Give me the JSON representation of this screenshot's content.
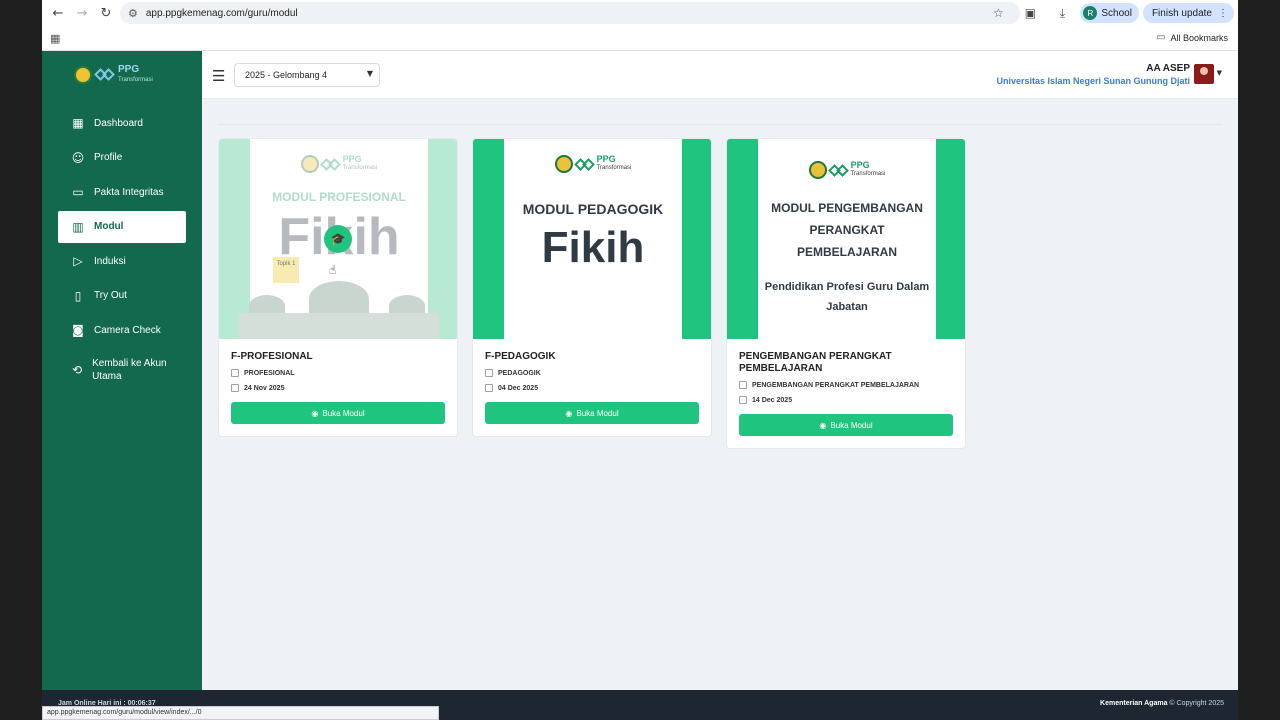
{
  "browser": {
    "url": "app.ppgkemenag.com/guru/modul",
    "profile_initial": "R",
    "profile_label": "School",
    "update_label": "Finish update",
    "bookmarks_label": "All Bookmarks"
  },
  "logo": {
    "text": "PPG",
    "sub": "Transformasi"
  },
  "sidebar": {
    "items": [
      {
        "label": "Dashboard"
      },
      {
        "label": "Profile"
      },
      {
        "label": "Pakta Integritas"
      },
      {
        "label": "Modul"
      },
      {
        "label": "Induksi"
      },
      {
        "label": "Try Out"
      },
      {
        "label": "Camera Check"
      },
      {
        "label": "Kembali ke Akun Utama"
      }
    ]
  },
  "header": {
    "period_select": "2025 - Gelombang 4",
    "user_name": "AA ASEP",
    "university": "Universitas Islam Negeri Sunan Gunung Djati"
  },
  "cards": [
    {
      "img_title": "MODUL PROFESIONAL",
      "img_big": "Fikih",
      "topic_tag": "Topik 1",
      "title": "F-PROFESIONAL",
      "category": "PROFESIONAL",
      "date": "24 Nov 2025",
      "button": "Buka Modul"
    },
    {
      "img_title": "MODUL PEDAGOGIK",
      "img_big": "Fikih",
      "title": "F-PEDAGOGIK",
      "category": "PEDAGOGIK",
      "date": "04 Dec 2025",
      "button": "Buka Modul"
    },
    {
      "img_title": "MODUL PENGEMBANGAN PERANGKAT PEMBELAJARAN",
      "img_sub": "Pendidikan Profesi Guru Dalam Jabatan",
      "title": "PENGEMBANGAN PERANGKAT PEMBELAJARAN",
      "category": "PENGEMBANGAN PERANGKAT PEMBELAJARAN",
      "date": "14 Dec 2025",
      "button": "Buka Modul"
    }
  ],
  "footer": {
    "left": "Jam Online Hari ini : 00:06:37",
    "org": "Kementerian Agama",
    "copyright": "© Copyright 2025"
  },
  "status_bar_url": "app.ppgkemenag.com/guru/modul/view/index/.../0",
  "colors": {
    "sidebar": "#12694e",
    "accent": "#1fc47f",
    "footer": "#1e2631"
  }
}
